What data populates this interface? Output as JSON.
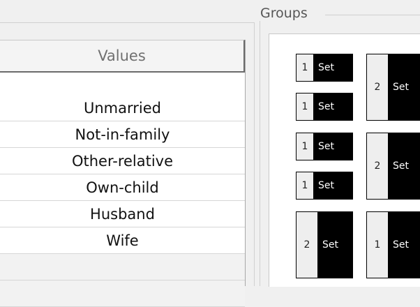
{
  "values_table": {
    "header": "Values",
    "rows": [
      "Unmarried",
      "Not-in-family",
      "Other-relative",
      "Own-child",
      "Husband",
      "Wife",
      "",
      ""
    ]
  },
  "groups": {
    "title": "Groups",
    "sets": [
      {
        "num": "1",
        "label": "Set"
      },
      {
        "num": "1",
        "label": "Set"
      },
      {
        "num": "2",
        "label": "Set"
      },
      {
        "num": "1",
        "label": "Set"
      },
      {
        "num": "1",
        "label": "Set"
      },
      {
        "num": "2",
        "label": "Set"
      },
      {
        "num": "2",
        "label": "Set"
      },
      {
        "num": "1",
        "label": "Set"
      }
    ]
  }
}
